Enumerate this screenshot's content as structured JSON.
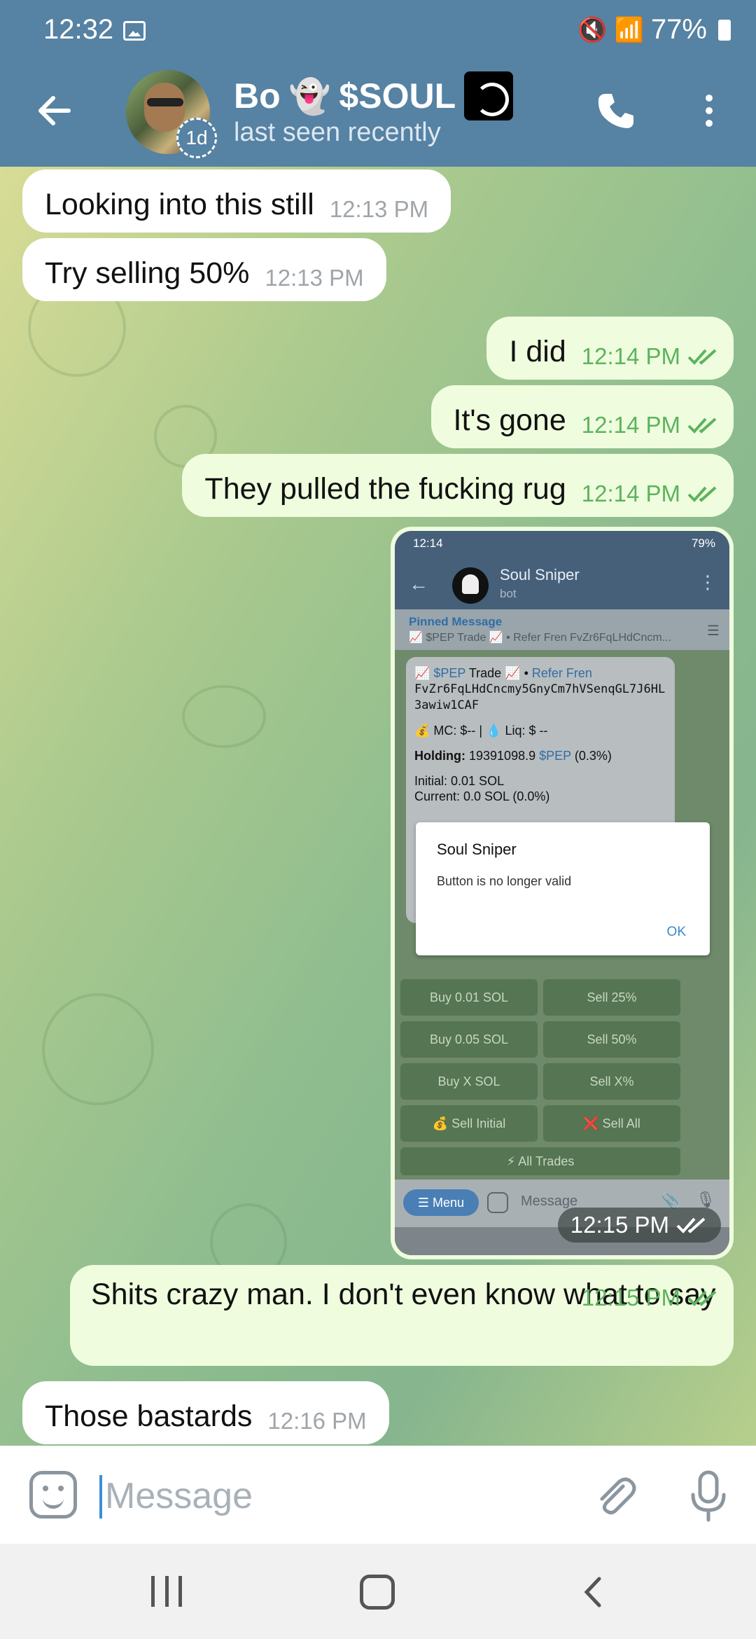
{
  "status_bar": {
    "time": "12:32",
    "battery": "77%"
  },
  "header": {
    "title": "Bo",
    "title_emoji": "👻",
    "title_suffix": "$SOUL",
    "subtitle": "last seen recently",
    "story_badge": "1d"
  },
  "messages": [
    {
      "side": "in",
      "text": "Looking into this still",
      "time": "12:13 PM"
    },
    {
      "side": "in",
      "text": "Try selling 50%",
      "time": "12:13 PM"
    },
    {
      "side": "out",
      "text": "I did",
      "time": "12:14 PM"
    },
    {
      "side": "out",
      "text": "It's gone",
      "time": "12:14 PM"
    },
    {
      "side": "out",
      "text": "They pulled the fucking rug",
      "time": "12:14 PM"
    },
    {
      "side": "out",
      "text": "Shits crazy man. I don't even know what to say",
      "time": "12:15 PM"
    },
    {
      "side": "in",
      "text": "Those bastards",
      "time": "12:16 PM"
    }
  ],
  "screenshot": {
    "time": "12:15 PM",
    "status_time": "12:14",
    "status_battery": "79%",
    "bot_name": "Soul Sniper",
    "bot_sub": "bot",
    "pinned_label": "Pinned Message",
    "pinned_text": "📈 $PEP Trade 📈 • Refer Fren FvZr6FqLHdCncm...",
    "trade_line_a": "📈 $PEP",
    "trade_line_b": "Trade 📈 •",
    "trade_line_c": "Refer Fren",
    "address": "FvZr6FqLHdCncmy5GnyCm7hVSenqGL7J6HL3awiw1CAF",
    "mc_line": "💰 MC: $-- | 💧 Liq: $ --",
    "holding_label": "Holding:",
    "holding_value": "19391098.9",
    "holding_token": "$PEP",
    "holding_pct": "(0.3%)",
    "initial": "Initial: 0.01 SOL",
    "current": "Current: 0.0 SOL (0.0%)",
    "dialog_title": "Soul Sniper",
    "dialog_body": "Button is no longer valid",
    "dialog_ok": "OK",
    "buttons": {
      "buy_001": "Buy 0.01 SOL",
      "sell_25": "Sell 25%",
      "buy_005": "Buy 0.05 SOL",
      "sell_50": "Sell 50%",
      "buy_x": "Buy X SOL",
      "sell_x": "Sell X%",
      "sell_initial": "💰 Sell Initial",
      "sell_all": "❌ Sell All",
      "all_trades": "⚡ All Trades"
    },
    "menu_label": "☰ Menu",
    "input_placeholder": "Message"
  },
  "input": {
    "placeholder": "Message"
  },
  "colors": {
    "header": "#5682a3",
    "outgoing": "#effdde",
    "incoming": "#ffffff",
    "check": "#5db35e"
  }
}
